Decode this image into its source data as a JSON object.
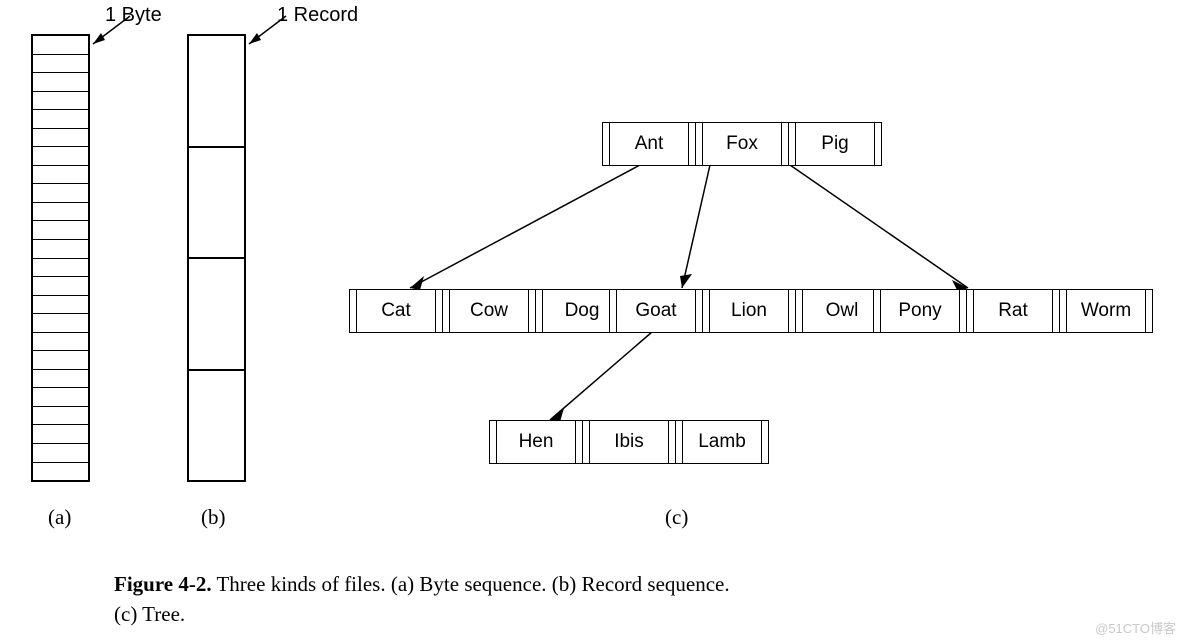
{
  "labels": {
    "byte": "1 Byte",
    "record": "1 Record",
    "a": "(a)",
    "b": "(b)",
    "c": "(c)"
  },
  "byte_rows": 24,
  "record_rows": 4,
  "tree": {
    "root": [
      "Ant",
      "Fox",
      "Pig"
    ],
    "children": [
      [
        "Cat",
        "Cow",
        "Dog"
      ],
      [
        "Goat",
        "Lion",
        "Owl"
      ],
      [
        "Pony",
        "Rat",
        "Worm"
      ]
    ],
    "grandchild": [
      "Hen",
      "Ibis",
      "Lamb"
    ]
  },
  "caption": {
    "fig": "Figure 4-2.",
    "text1": " Three kinds of files. (a) Byte sequence. (b) Record sequence.",
    "text2": "(c) Tree."
  },
  "watermark": "@51CTO博客"
}
